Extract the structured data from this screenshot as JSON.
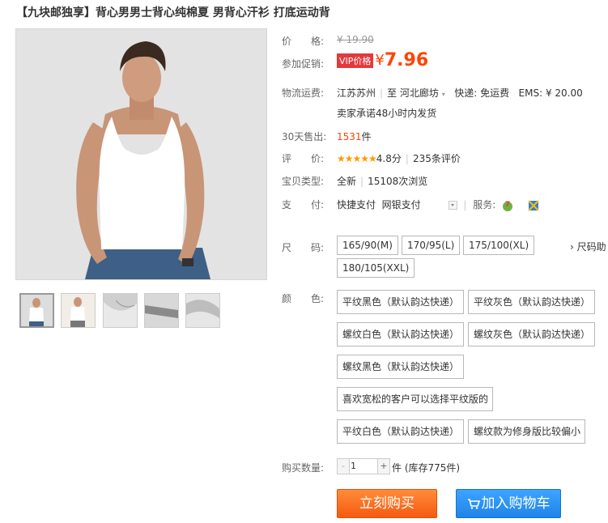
{
  "title": "【九块邮独享】背心男男士背心纯棉夏 男背心汗衫 打底运动背",
  "price": {
    "label": "价　　格:",
    "value": "¥ 19.90"
  },
  "promo": {
    "label": "参加促销:",
    "badge": "VIP价格",
    "currency": "¥",
    "value": "7.96"
  },
  "shipping": {
    "label": "物流运费:",
    "from": "江苏苏州",
    "to_prefix": "至",
    "to": "河北廊坊",
    "express": "快递: 免运费",
    "ems": "EMS: ¥ 20.00",
    "promise": "卖家承诺48小时内发货"
  },
  "sales": {
    "label": "30天售出:",
    "count": "1531",
    "unit": "件"
  },
  "rating": {
    "label": "评　　价:",
    "stars": "★★★★★",
    "score": "4.8分",
    "reviews": "235条评价"
  },
  "item_type": {
    "label": "宝贝类型:",
    "value": "全新",
    "views": "15108次浏览"
  },
  "payment": {
    "label": "支　　付:",
    "fast_pay": "快捷支付",
    "bank_pay": "网银支付",
    "service_label": "服务:"
  },
  "size": {
    "label": "尺　　码:",
    "options": [
      "165/90(M)",
      "170/95(L)",
      "175/100(XL)",
      "180/105(XXL)"
    ],
    "help": "› 尺码助"
  },
  "color": {
    "label": "颜　　色:",
    "options": [
      "平纹黑色（默认韵达快递）",
      "平纹灰色（默认韵达快递）",
      "螺纹白色（默认韵达快递）",
      "螺纹灰色（默认韵达快递）",
      "螺纹黑色（默认韵达快递）",
      "喜欢宽松的客户可以选择平纹版的",
      "平纹白色（默认韵达快递）",
      "螺纹款为修身版比较偏小"
    ]
  },
  "quantity": {
    "label": "购买数量:",
    "value": "1",
    "minus": "-",
    "plus": "+",
    "stock": "件 (库存775件)"
  },
  "actions": {
    "buy_now": "立刻购买",
    "add_cart": "加入购物车"
  },
  "colors": {
    "accent": "#ff4400",
    "buy": "#f55a10",
    "cart": "#1e84e8"
  }
}
